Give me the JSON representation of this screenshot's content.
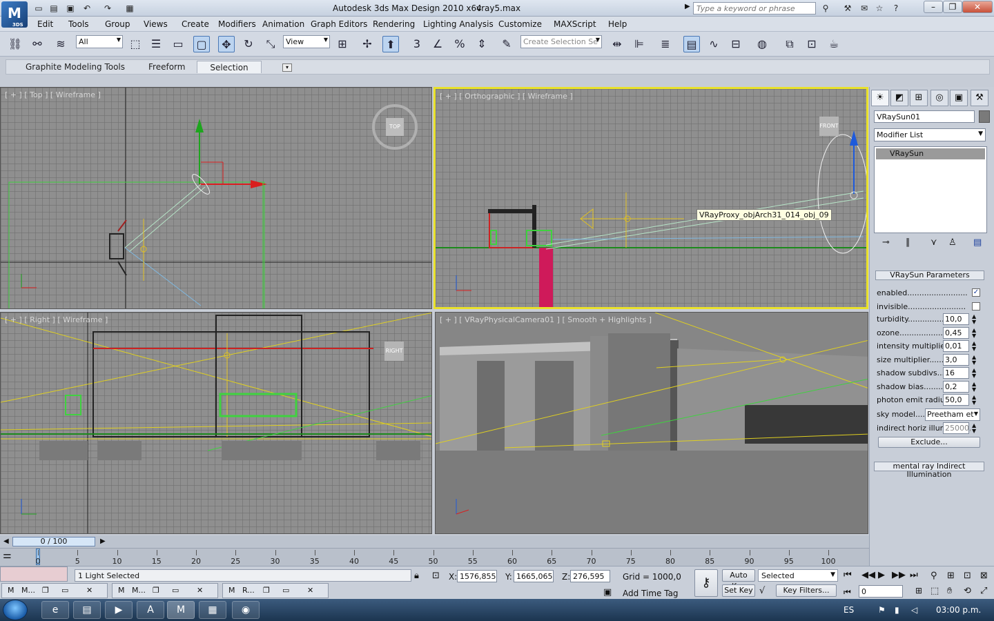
{
  "titlebar": {
    "app_title": "Autodesk 3ds Max Design 2010 x64",
    "file_name": "vray5.max",
    "search_placeholder": "Type a keyword or phrase",
    "logo_text": "3DS"
  },
  "menu": [
    "Edit",
    "Tools",
    "Group",
    "Views",
    "Create",
    "Modifiers",
    "Animation",
    "Graph Editors",
    "Rendering",
    "Lighting Analysis",
    "Customize",
    "MAXScript",
    "Help"
  ],
  "toolbar": {
    "selection_filter": "All",
    "ref_coord": "View",
    "selection_set_placeholder": "Create Selection Se"
  },
  "ribbon": {
    "tabs": [
      "Graphite Modeling Tools",
      "Freeform",
      "Selection"
    ],
    "active_tab": "Selection"
  },
  "viewports": {
    "top": {
      "label": "[ + ] [ Top ] [ Wireframe ]",
      "cube": "TOP"
    },
    "ortho": {
      "label": "[ + ] [ Orthographic ] [ Wireframe ]",
      "cube": "FRONT",
      "tooltip": "VRayProxy_objArch31_014_obj_09"
    },
    "right": {
      "label": "[ + ] [ Right ] [ Wireframe ]",
      "cube": "RIGHT"
    },
    "camera": {
      "label": "[ + ] [ VRayPhysicalCamera01 ] [ Smooth + Highlights ]"
    }
  },
  "command_panel": {
    "object_name": "VRaySun01",
    "modifier_list": "Modifier List",
    "stack_item": "VRaySun",
    "rollout_title": "VRaySun Parameters",
    "params": [
      {
        "label": "enabled.........................",
        "type": "check",
        "value": "✓"
      },
      {
        "label": "invisible........................",
        "type": "check",
        "value": ""
      },
      {
        "label": "turbidity................",
        "type": "num",
        "value": "10,0"
      },
      {
        "label": "ozone..................",
        "type": "num",
        "value": "0,45"
      },
      {
        "label": "intensity multiplier..",
        "type": "num",
        "value": "0,01"
      },
      {
        "label": "size multiplier.........",
        "type": "num",
        "value": "3,0"
      },
      {
        "label": "shadow subdivs.....",
        "type": "num",
        "value": "16"
      },
      {
        "label": "shadow bias.........",
        "type": "num",
        "value": "0,2"
      },
      {
        "label": "photon emit radius.",
        "type": "num",
        "value": "50,0"
      }
    ],
    "sky_model_label": "sky model.....",
    "sky_model_value": "Preetham et",
    "indirect_label": "indirect horiz illum...",
    "indirect_value": "25000,",
    "exclude_button": "Exclude...",
    "mr_rollout": "mental ray Indirect Illumination"
  },
  "timeline": {
    "slider_text": "0 / 100",
    "ticks": [
      "0",
      "5",
      "10",
      "15",
      "20",
      "25",
      "30",
      "35",
      "40",
      "45",
      "50",
      "55",
      "60",
      "65",
      "70",
      "75",
      "80",
      "85",
      "90",
      "95",
      "100"
    ]
  },
  "status": {
    "selection": "1 Light Selected",
    "x_label": "X:",
    "x_value": "1576,855",
    "y_label": "Y:",
    "y_value": "1665,065",
    "z_label": "Z:",
    "z_value": "276,595",
    "grid": "Grid = 1000,0",
    "add_time_tag": "Add Time Tag",
    "auto_key": "Auto Key",
    "set_key": "Set Key",
    "key_mode": "Selected",
    "key_filters": "Key Filters...",
    "frame": "0",
    "mini_windows": [
      "M...",
      "M...",
      "R..."
    ]
  },
  "taskbar": {
    "language": "ES",
    "clock": "03:00 p.m."
  }
}
